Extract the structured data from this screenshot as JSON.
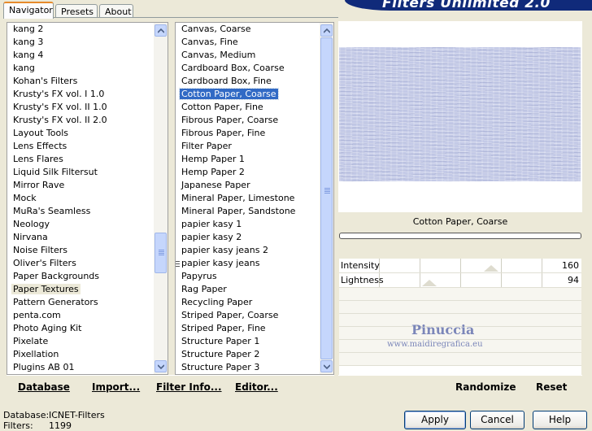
{
  "banner": {
    "title": "Filters Unlimited 2.0"
  },
  "tabs": [
    {
      "label": "Navigator",
      "active": true
    },
    {
      "label": "Presets",
      "active": false
    },
    {
      "label": "About",
      "active": false
    }
  ],
  "categories": {
    "items": [
      "kang 2",
      "kang 3",
      "kang 4",
      "kang",
      "Kohan's Filters",
      "Krusty's FX vol. I 1.0",
      "Krusty's FX vol. II 1.0",
      "Krusty's FX vol. II 2.0",
      "Layout Tools",
      "Lens Effects",
      "Lens Flares",
      "Liquid Silk Filtersut",
      "Mirror Rave",
      "Mock",
      "MuRa's Seamless",
      "Neology",
      "Nirvana",
      "Noise Filters",
      "Oliver's Filters",
      "Paper Backgrounds",
      "Paper Textures",
      "Pattern Generators",
      "penta.com",
      "Photo Aging Kit",
      "Pixelate",
      "Pixellation",
      "Plugins AB 01"
    ],
    "selected": "Paper Textures"
  },
  "filters": {
    "items": [
      "Canvas, Coarse",
      "Canvas, Fine",
      "Canvas, Medium",
      "Cardboard Box, Coarse",
      "Cardboard Box, Fine",
      "Cotton Paper, Coarse",
      "Cotton Paper, Fine",
      "Fibrous Paper, Coarse",
      "Fibrous Paper, Fine",
      "Filter Paper",
      "Hemp Paper 1",
      "Hemp Paper 2",
      "Japanese Paper",
      "Mineral Paper, Limestone",
      "Mineral Paper, Sandstone",
      "papier kasy 1",
      "papier kasy 2",
      "papier kasy jeans 2",
      "papier kasy jeans",
      "Papyrus",
      "Rag Paper",
      "Recycling Paper",
      "Striped Paper, Coarse",
      "Striped Paper, Fine",
      "Structure Paper 1",
      "Structure Paper 2",
      "Structure Paper 3"
    ],
    "selected": "Cotton Paper, Coarse"
  },
  "toolbar_left": {
    "database": "Database",
    "import": "Import...",
    "filter_info": "Filter Info...",
    "editor": "Editor..."
  },
  "preview": {
    "filter_name": "Cotton Paper, Coarse",
    "texture_color": "#c4cae7"
  },
  "params": [
    {
      "label": "Intensity",
      "value": "160"
    },
    {
      "label": "Lightness",
      "value": "94"
    }
  ],
  "watermark": {
    "name": "Pinuccia",
    "site": "www.maidiregrafica.eu"
  },
  "toolbar_right": {
    "randomize": "Randomize",
    "reset": "Reset"
  },
  "status": {
    "database_label": "Database:",
    "database_value": "ICNET-Filters",
    "filters_label": "Filters:",
    "filters_value": "1199"
  },
  "buttons": {
    "apply": "Apply",
    "cancel": "Cancel",
    "help": "Help"
  }
}
